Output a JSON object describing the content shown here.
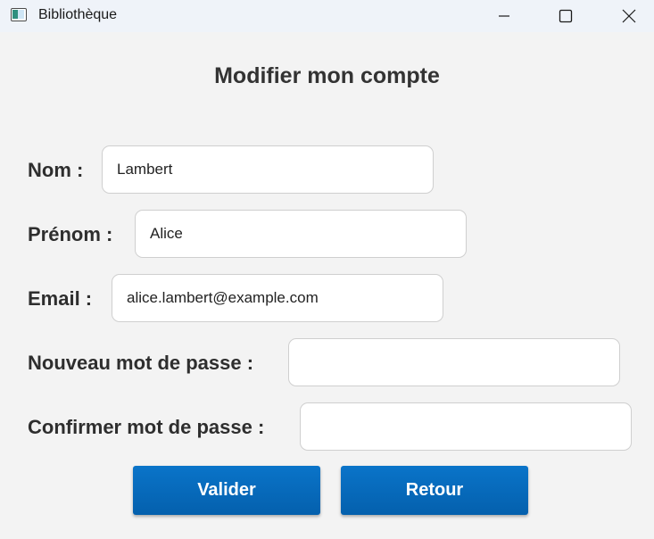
{
  "window": {
    "title": "Bibliothèque",
    "controls": [
      "minimize-icon",
      "maximize-icon",
      "close-icon"
    ]
  },
  "form": {
    "title": "Modifier mon compte",
    "fields": {
      "nom": {
        "label": "Nom :",
        "value": "Lambert",
        "placeholder": ""
      },
      "prenom": {
        "label": "Prénom :",
        "value": "Alice",
        "placeholder": ""
      },
      "email": {
        "label": "Email :",
        "value": "alice.lambert@example.com",
        "placeholder": ""
      },
      "new_password": {
        "label": "Nouveau mot de passe :",
        "value": "",
        "placeholder": ""
      },
      "confirm_password": {
        "label": "Confirmer mot de passe :",
        "value": "",
        "placeholder": ""
      }
    },
    "buttons": {
      "validate": "Valider",
      "back": "Retour"
    }
  },
  "colors": {
    "accent": "#0a6cc0",
    "background": "#f3f3f3",
    "titlebar": "#eff3f9"
  }
}
